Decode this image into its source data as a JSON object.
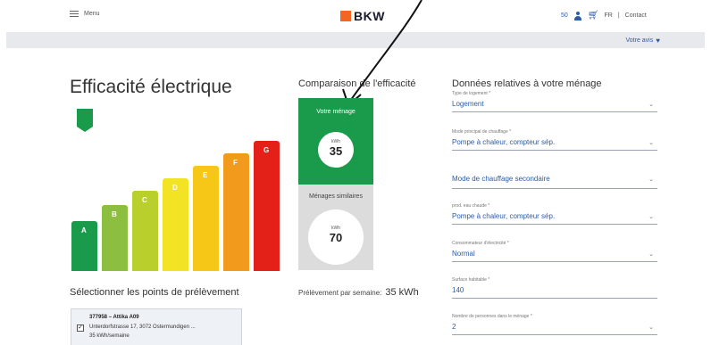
{
  "header": {
    "menu_label": "Menu",
    "brand": "BKW",
    "brand_color": "#f26522",
    "user_number": "50",
    "lang": "FR",
    "separator": "|",
    "contact": "Contact"
  },
  "banner": {
    "feedback_label": "Votre avis"
  },
  "efficiency": {
    "title": "Efficacité électrique",
    "selected_class": "A",
    "classes": [
      {
        "label": "A",
        "color": "#1a9a4b"
      },
      {
        "label": "B",
        "color": "#8cbf3f"
      },
      {
        "label": "C",
        "color": "#b9cf2b"
      },
      {
        "label": "D",
        "color": "#f2e324"
      },
      {
        "label": "E",
        "color": "#f7c718"
      },
      {
        "label": "F",
        "color": "#f19a1b"
      },
      {
        "label": "G",
        "color": "#e32119"
      }
    ]
  },
  "comparison": {
    "title": "Comparaison de l'efficacité",
    "own": {
      "label": "Votre ménage",
      "unit": "kWh",
      "value": "35",
      "color": "#1a9a4b"
    },
    "similar": {
      "label": "Ménages similaires",
      "unit": "kWh",
      "value": "70"
    },
    "weekly_label": "Prélèvement par semaine:",
    "weekly_value": "35 kWh"
  },
  "selection": {
    "title": "Sélectionner les points de prélèvement",
    "item": {
      "checked": "✓",
      "line1": "377958 – Attika A09",
      "line2": "Unterdorfstrasse 17, 3072 Ostermundigen ...",
      "line3": "35 kWh/semaine"
    }
  },
  "form": {
    "title": "Données relatives à votre ménage",
    "fields": [
      {
        "label": "Type de logement *",
        "value": "Logement"
      },
      {
        "label": "Mode principal de chauffage *",
        "value": "Pompe à chaleur, compteur sép."
      },
      {
        "label": "",
        "value": "Mode de chauffage secondaire"
      },
      {
        "label": "prod. eau chaude *",
        "value": "Pompe à chaleur, compteur sép."
      },
      {
        "label": "Consommateur d'électricité *",
        "value": "Normal"
      },
      {
        "label": "Surface habitable *",
        "value": "140"
      },
      {
        "label": "Nombre de personnes dans le ménage *",
        "value": "2"
      }
    ]
  },
  "icons": {
    "menu": "hamburger-icon",
    "user": "user-icon",
    "cart": "cart-icon",
    "heart": "heart-icon",
    "chevron": "chevron-down-icon",
    "shield": "shield-icon"
  }
}
